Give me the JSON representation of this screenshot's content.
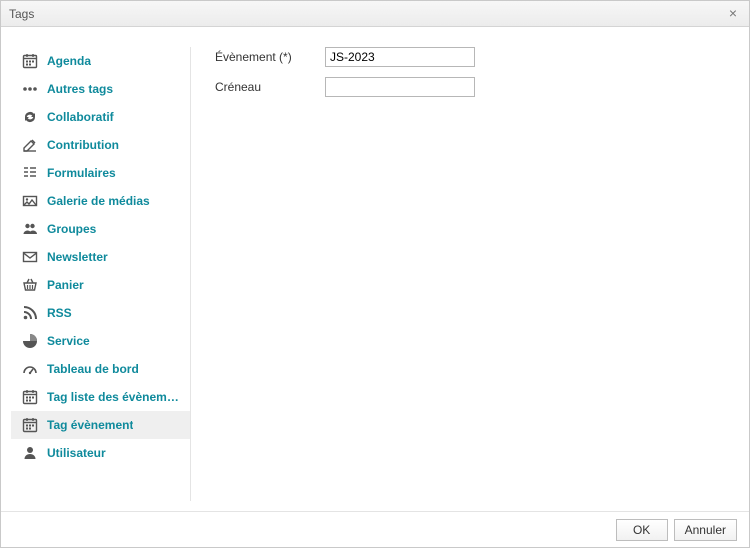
{
  "dialog": {
    "title": "Tags",
    "close_glyph": "×"
  },
  "sidebar": {
    "items": [
      {
        "icon": "calendar",
        "label": "Agenda"
      },
      {
        "icon": "dots",
        "label": "Autres tags"
      },
      {
        "icon": "refresh",
        "label": "Collaboratif"
      },
      {
        "icon": "edit",
        "label": "Contribution"
      },
      {
        "icon": "form",
        "label": "Formulaires"
      },
      {
        "icon": "gallery",
        "label": "Galerie de médias"
      },
      {
        "icon": "group",
        "label": "Groupes"
      },
      {
        "icon": "envelope",
        "label": "Newsletter"
      },
      {
        "icon": "basket",
        "label": "Panier"
      },
      {
        "icon": "rss",
        "label": "RSS"
      },
      {
        "icon": "pie",
        "label": "Service"
      },
      {
        "icon": "dashboard",
        "label": "Tableau de bord"
      },
      {
        "icon": "calendar",
        "label": "Tag liste des évènements"
      },
      {
        "icon": "calendar",
        "label": "Tag évènement"
      },
      {
        "icon": "user",
        "label": "Utilisateur"
      }
    ],
    "selected_index": 13
  },
  "form": {
    "event_label": "Évènement (*)",
    "event_value": "JS-2023",
    "slot_label": "Créneau",
    "slot_value": ""
  },
  "footer": {
    "ok_label": "OK",
    "cancel_label": "Annuler"
  }
}
